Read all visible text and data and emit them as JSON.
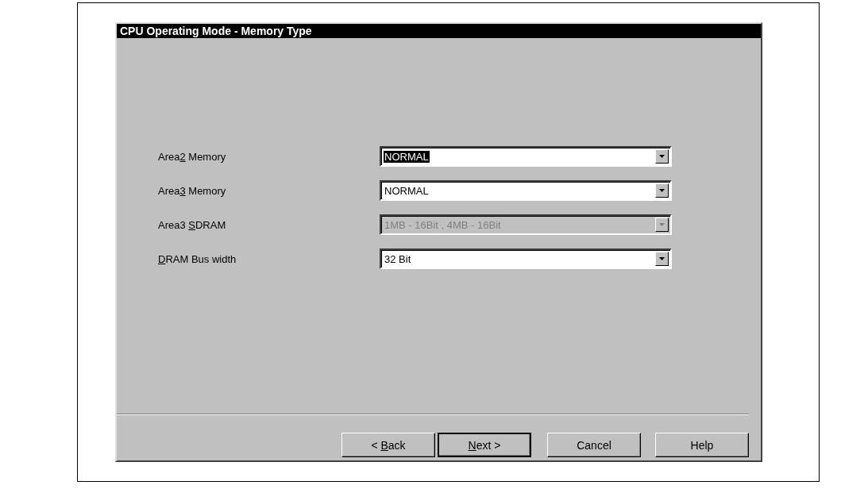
{
  "window": {
    "title": "CPU Operating Mode - Memory Type"
  },
  "fields": [
    {
      "label": {
        "before": "Area",
        "key": "2",
        "after": " Memory"
      },
      "value": "NORMAL",
      "text_selected": true,
      "disabled": false
    },
    {
      "label": {
        "before": "Area",
        "key": "3",
        "after": " Memory"
      },
      "value": "NORMAL",
      "text_selected": false,
      "disabled": false
    },
    {
      "label": {
        "before": "Area3 ",
        "key": "S",
        "after": "DRAM"
      },
      "value": "1MB - 16Bit , 4MB - 16Bit",
      "text_selected": false,
      "disabled": true
    },
    {
      "label": {
        "key": "D",
        "after": "RAM Bus width"
      },
      "value": "32 Bit",
      "text_selected": false,
      "disabled": false
    }
  ],
  "buttons": [
    {
      "label": {
        "before": "< ",
        "key": "B",
        "after": "ack"
      },
      "default": false
    },
    {
      "label": {
        "key": "N",
        "after": "ext >"
      },
      "default": true
    },
    {
      "label": {
        "before": "Cancel"
      },
      "default": false
    },
    {
      "label": {
        "before": "Help"
      },
      "default": false
    }
  ]
}
